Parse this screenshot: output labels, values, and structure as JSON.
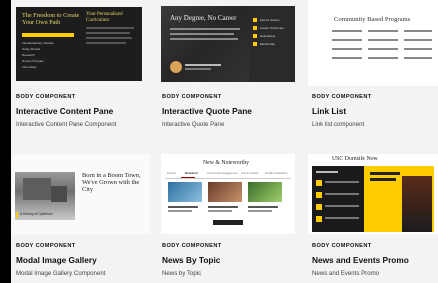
{
  "cards": [
    {
      "kicker": "BODY COMPONENT",
      "title": "Interactive Content Pane",
      "subtitle": "Interactive Content Pane Component",
      "thumb": {
        "left_title": "The Freedom to Create Your Own Path",
        "right_title": "Your Personalized Curriculum",
        "menu": [
          "Interdisciplinary Studies",
          "Study Abroad",
          "Research",
          "Honors Program",
          "Internships"
        ]
      }
    },
    {
      "kicker": "BODY COMPONENT",
      "title": "Interactive Quote Pane",
      "subtitle": "Interactive Quote Pane",
      "thumb": {
        "headline": "Any Degree, No Career",
        "menu": [
          "Alumni Stories",
          "Career Outcomes",
          "Networking",
          "Mentorship"
        ]
      }
    },
    {
      "kicker": "BODY COMPONENT",
      "title": "Link List",
      "subtitle": "Link list component",
      "thumb": {
        "heading": "Community Based Programs"
      }
    },
    {
      "kicker": "BODY COMPONENT",
      "title": "Modal Image Gallery",
      "subtitle": "Modal Image Gallery Component",
      "thumb": {
        "headline": "Born in a Boom Town, We've Grown with the City",
        "caption": "A History of Optimism"
      }
    },
    {
      "kicker": "BODY COMPONENT",
      "title": "News By Topic",
      "subtitle": "News by Topic",
      "thumb": {
        "heading": "New & Noteworthy",
        "tabs": [
          "Faculty",
          "Research",
          "Community Engagement",
          "Arts & Culture",
          "Health & Medicine"
        ],
        "active_tab": "Research"
      }
    },
    {
      "kicker": "BODY COMPONENT",
      "title": "News and Events Promo",
      "subtitle": "News and Events Promo",
      "thumb": {
        "heading": "USC Dornsife Now"
      }
    }
  ]
}
